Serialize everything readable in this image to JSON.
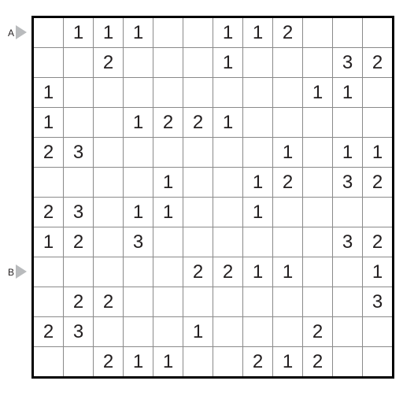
{
  "chart_data": {
    "type": "table",
    "title": "",
    "rows": 12,
    "cols": 12,
    "row_markers": [
      {
        "index": 0,
        "label": "A"
      },
      {
        "index": 8,
        "label": "B"
      }
    ],
    "cells": [
      [
        "",
        "1",
        "1",
        "1",
        "",
        "",
        "1",
        "1",
        "2",
        "",
        "",
        ""
      ],
      [
        "",
        "",
        "2",
        "",
        "",
        "",
        "1",
        "",
        "",
        "",
        "3",
        "2"
      ],
      [
        "1",
        "",
        "",
        "",
        "",
        "",
        "",
        "",
        "",
        "1",
        "1",
        ""
      ],
      [
        "1",
        "",
        "",
        "1",
        "2",
        "2",
        "1",
        "",
        "",
        "",
        "",
        ""
      ],
      [
        "2",
        "3",
        "",
        "",
        "",
        "",
        "",
        "",
        "1",
        "",
        "1",
        "1"
      ],
      [
        "",
        "",
        "",
        "",
        "1",
        "",
        "",
        "1",
        "2",
        "",
        "3",
        "2"
      ],
      [
        "2",
        "3",
        "",
        "1",
        "1",
        "",
        "",
        "1",
        "",
        "",
        "",
        ""
      ],
      [
        "1",
        "2",
        "",
        "3",
        "",
        "",
        "",
        "",
        "",
        "",
        "3",
        "2"
      ],
      [
        "",
        "",
        "",
        "",
        "",
        "2",
        "2",
        "1",
        "1",
        "",
        "",
        "1"
      ],
      [
        "",
        "2",
        "2",
        "",
        "",
        "",
        "",
        "",
        "",
        "",
        "",
        "3"
      ],
      [
        "2",
        "3",
        "",
        "",
        "",
        "1",
        "",
        "",
        "",
        "2",
        "",
        ""
      ],
      [
        "",
        "",
        "2",
        "1",
        "1",
        "",
        "",
        "2",
        "1",
        "2",
        "",
        ""
      ]
    ]
  }
}
